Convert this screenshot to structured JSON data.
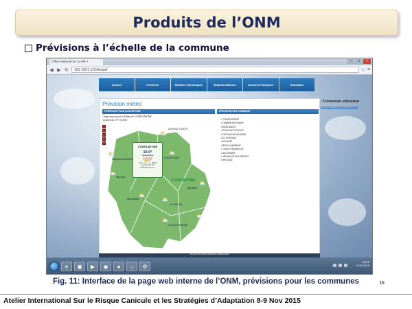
{
  "slide": {
    "title": "Produits de l’ONM",
    "bullet": "Prévisions à l’échelle de la commune",
    "caption": "Fig. 11: Interface de la page web interne de l’ONM, prévisions pour les communes",
    "page_number": "16",
    "footer": "Atelier International  Sur le Risque Canicule et les Stratégies d’Adaptation 8-9 Nov 2015"
  },
  "browser": {
    "tab_title": "Office National de La Mé ×",
    "address": "192.168.0.125/drupal/",
    "window_buttons": [
      "–",
      "□",
      "×"
    ]
  },
  "site": {
    "nav": [
      "Accueil",
      "Prévision",
      "Modèles Numériques",
      "Modèles Marines",
      "Données Publiques",
      "Actualités"
    ],
    "panel_title": "Prévision météo",
    "col_algo": "PRÉVISION POUR ALGORITHME",
    "col_commune": "PRÉVISION PAR COMMUNE",
    "forecast_lines": [
      "Temps prévu pour la Wilaya de CONSTANTINE",
      "Journée du : 07-11-2015"
    ],
    "popup": {
      "city": "CONSTANTINE",
      "temp": "19.0°",
      "lines": [
        "Température",
        "Tmax:19.0°",
        "Tmin:8.0°",
        "Vent : 11 Km/h NNW",
        "Humidité:69.0%",
        "Visibilité:20.0 Km"
      ]
    },
    "map_labels": [
      "ZIGHOUD YOUCEF",
      "MESAOUD BOUJRIOU",
      "OUCHE HAMA",
      "IBN ZIAD",
      "CONSTANTINE",
      "AIN SMARA",
      "EL KHROUB",
      "OULED RAHMOUN",
      "AIN ABID"
    ],
    "communes": [
      "CONSTANTINE",
      "HAMMA BOUZIANE",
      "BENI BADIS",
      "ZIGHOUD YOUCEF",
      "DIDOUCHE MOURAD",
      "EL KHROUB",
      "AIN ABID",
      "BENI HAMIDENE",
      "OULED RAHMOUN",
      "AIN SMARA",
      "MESAOUD BOUJERIOU",
      "IBN ZIAD"
    ],
    "sidebar_title": "Connexion utilisateur",
    "sidebar_link": "Demander un nouveau mot de passe",
    "footer": "Copyright 2015 Office National de la Météorologie"
  },
  "taskbar": {
    "time": "08:32",
    "date": "07/11/2015"
  }
}
